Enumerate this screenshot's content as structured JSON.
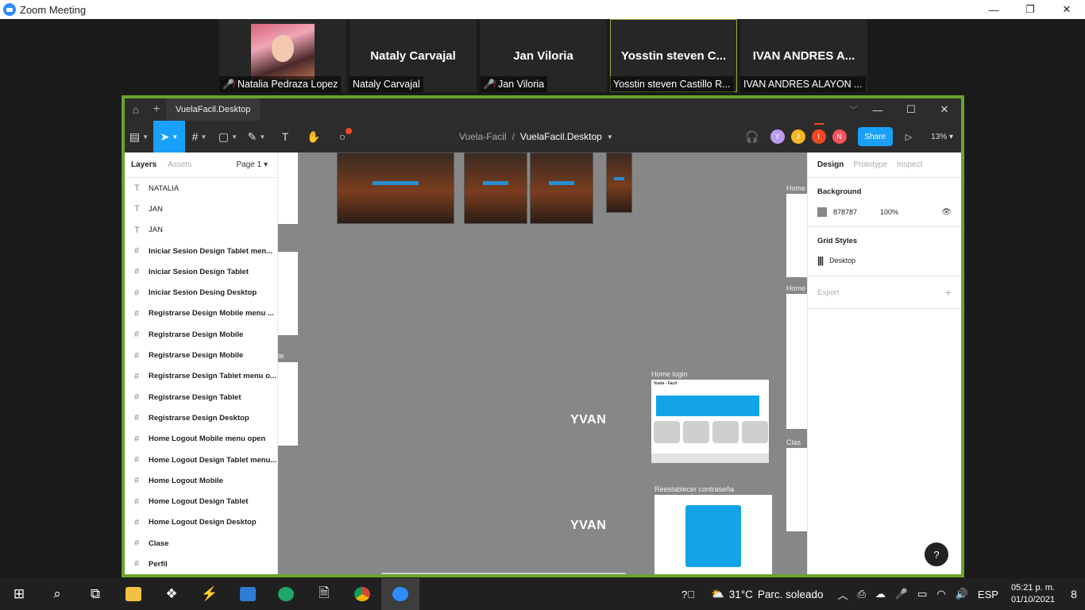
{
  "zoom": {
    "window_title": "Zoom Meeting",
    "window_controls": [
      "—",
      "❐",
      "✕"
    ],
    "participants": [
      {
        "big_name": "",
        "caption": "Natalia Pedraza Lopez",
        "muted": true,
        "has_video": true
      },
      {
        "big_name": "Nataly Carvajal",
        "caption": "Nataly Carvajal",
        "muted": false,
        "has_video": false
      },
      {
        "big_name": "Jan Viloria",
        "caption": "Jan Viloria",
        "muted": true,
        "has_video": false
      },
      {
        "big_name": "Yosstin steven C...",
        "caption": "Yosstin steven Castillo R...",
        "muted": false,
        "has_video": false,
        "active_speaker": true
      },
      {
        "big_name": "IVAN ANDRES A...",
        "caption": "IVAN ANDRES ALAYON ...",
        "muted": false,
        "has_video": false
      }
    ]
  },
  "figma": {
    "tab_name": "VuelaFacil.Desktop",
    "breadcrumb_project": "Vuela-Facil",
    "breadcrumb_separator": "/",
    "breadcrumb_file": "VuelaFacil.Desktop",
    "share_label": "Share",
    "zoom_level": "13%",
    "collaborators": [
      {
        "initial": "Y",
        "color": "#b99bf0"
      },
      {
        "initial": "J",
        "color": "#f5b825"
      },
      {
        "initial": "I",
        "color": "#f24822"
      },
      {
        "initial": "N",
        "color": "#f2545b"
      }
    ],
    "layers_panel": {
      "tab_active": "Layers",
      "tab_inactive": "Assets",
      "page_selector": "Page 1",
      "layers": [
        {
          "type": "text",
          "name": "NATALIA"
        },
        {
          "type": "text",
          "name": "JAN"
        },
        {
          "type": "text",
          "name": "JAN"
        },
        {
          "type": "frame",
          "name": "Iniciar Sesion Design Tablet men..."
        },
        {
          "type": "frame",
          "name": "Iniciar Sesion Design Tablet"
        },
        {
          "type": "frame",
          "name": "Iniciar Sesion Desing Desktop"
        },
        {
          "type": "frame",
          "name": "Registrarse Design Mobile menu ..."
        },
        {
          "type": "frame",
          "name": "Registrarse Design Mobile"
        },
        {
          "type": "frame",
          "name": "Registrarse Design Mobile"
        },
        {
          "type": "frame",
          "name": "Registrarse Design Tablet menu o..."
        },
        {
          "type": "frame",
          "name": "Registrarse Design Tablet"
        },
        {
          "type": "frame",
          "name": "Registrarse Design Desktop"
        },
        {
          "type": "frame",
          "name": "Home Logout Mobile menu open"
        },
        {
          "type": "frame",
          "name": "Home Logout Design Tablet menu..."
        },
        {
          "type": "frame",
          "name": "Home Logout Mobile"
        },
        {
          "type": "frame",
          "name": "Home Logout Design Tablet"
        },
        {
          "type": "frame",
          "name": "Home Logout Design Desktop"
        },
        {
          "type": "frame",
          "name": "Clase"
        },
        {
          "type": "frame",
          "name": "Perfil"
        }
      ]
    },
    "canvas": {
      "text_labels": [
        "YVAN",
        "YVAN"
      ],
      "frame_labels": [
        "Home login",
        "Reestablecer contraseña",
        "Home",
        "Home",
        "Clas",
        "te"
      ],
      "home_login_brand": "Vuela - Facil"
    },
    "design_panel": {
      "tabs": [
        "Design",
        "Prototype",
        "Inspect"
      ],
      "background_title": "Background",
      "background_hex": "878787",
      "background_opacity": "100%",
      "grid_styles_title": "Grid Styles",
      "grid_style_name": "Desktop",
      "export_label": "Export",
      "help_label": "?"
    }
  },
  "taskbar": {
    "weather_temp": "31°C",
    "weather_desc": "Parc. soleado",
    "language": "ESP",
    "time": "05:21 p. m.",
    "date": "01/10/2021",
    "notifications_count": "8"
  }
}
